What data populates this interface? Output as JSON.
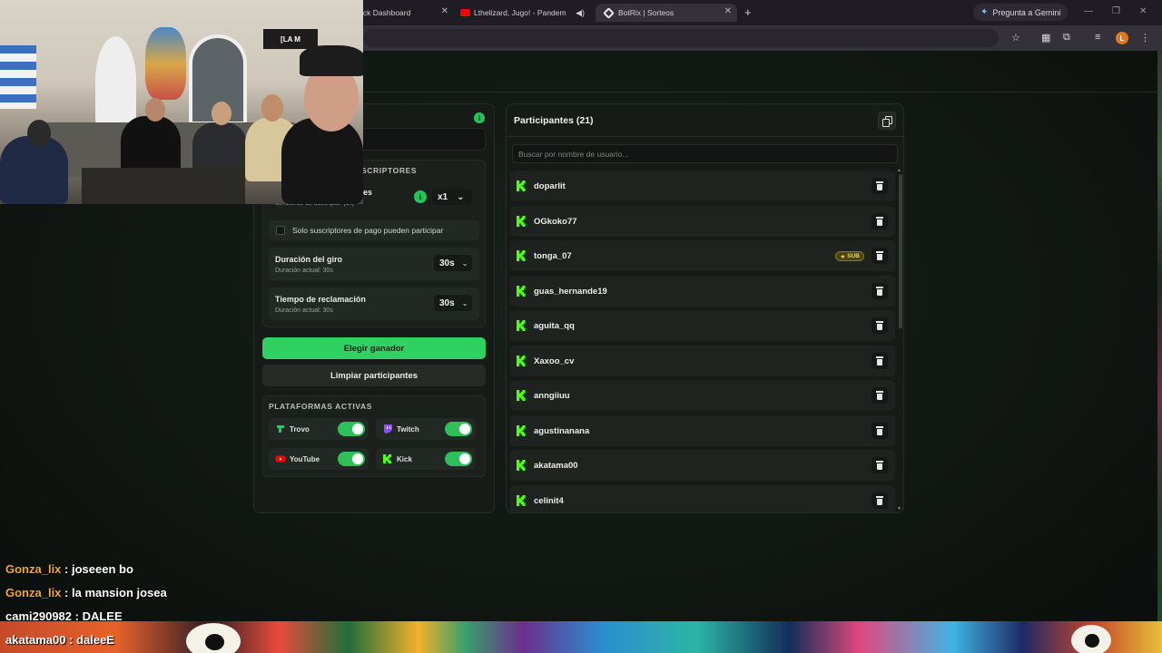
{
  "browser": {
    "tabs": [
      {
        "label": "ick Dashboard"
      },
      {
        "label": "Lthelizard, Jugo! - Pandem"
      },
      {
        "label": "BotRix | Sorteos"
      }
    ],
    "gemini_label": "Pregunta a Gemini",
    "profile_initial": "L"
  },
  "settings": {
    "section_title": "SCRIPTORES",
    "multiplier_label": "es",
    "multiplier_sub": "Sin bonus de suscriptor (1x)",
    "multiplier_value": "x1",
    "subs_only_label": "Solo suscriptores de pago pueden participar",
    "spin_duration": {
      "title": "Duración del giro",
      "sub": "Duración actual: 30s",
      "value": "30s"
    },
    "claim_time": {
      "title": "Tiempo de reclamación",
      "sub": "Duración actual: 30s",
      "value": "30s"
    },
    "pick_winner": "Elegir ganador",
    "clear_participants": "Limpiar participantes",
    "platforms_title": "PLATAFORMAS ACTIVAS",
    "platforms": [
      {
        "name": "Trovo",
        "enabled": true,
        "color": "#19d06b"
      },
      {
        "name": "Twitch",
        "enabled": true,
        "color": "#9146ff"
      },
      {
        "name": "YouTube",
        "enabled": true,
        "color": "#ff0000"
      },
      {
        "name": "Kick",
        "enabled": true,
        "color": "#53fc18"
      }
    ]
  },
  "participants": {
    "title": "Participantes (21)",
    "search_placeholder": "Buscar por nombre de usuario...",
    "sub_badge": "SUB",
    "items": [
      {
        "name": "doparlit",
        "sub": false
      },
      {
        "name": "OGkoko77",
        "sub": false
      },
      {
        "name": "tonga_07",
        "sub": true
      },
      {
        "name": "guas_hernande19",
        "sub": false
      },
      {
        "name": "aguita_qq",
        "sub": false
      },
      {
        "name": "Xaxoo_cv",
        "sub": false
      },
      {
        "name": "anngiiuu",
        "sub": false
      },
      {
        "name": "agustinanana",
        "sub": false
      },
      {
        "name": "akatama00",
        "sub": false
      },
      {
        "name": "celinit4",
        "sub": false
      }
    ]
  },
  "webcam": {
    "sign_text": "[LA M"
  },
  "chat": [
    {
      "user": "Gonza_lix",
      "message": "joseeen bo",
      "color": "#f0a832"
    },
    {
      "user": "Gonza_lix",
      "message": "la mansion josea",
      "color": "#f0a832"
    },
    {
      "user": "cami290982",
      "message": "DALEE",
      "color": "#ffffff"
    },
    {
      "user": "akatama00",
      "message": "daleeE",
      "color": "#ffffff"
    }
  ],
  "colors": {
    "accent": "#2fd163",
    "kick": "#53fc18",
    "panel": "#171b18"
  }
}
